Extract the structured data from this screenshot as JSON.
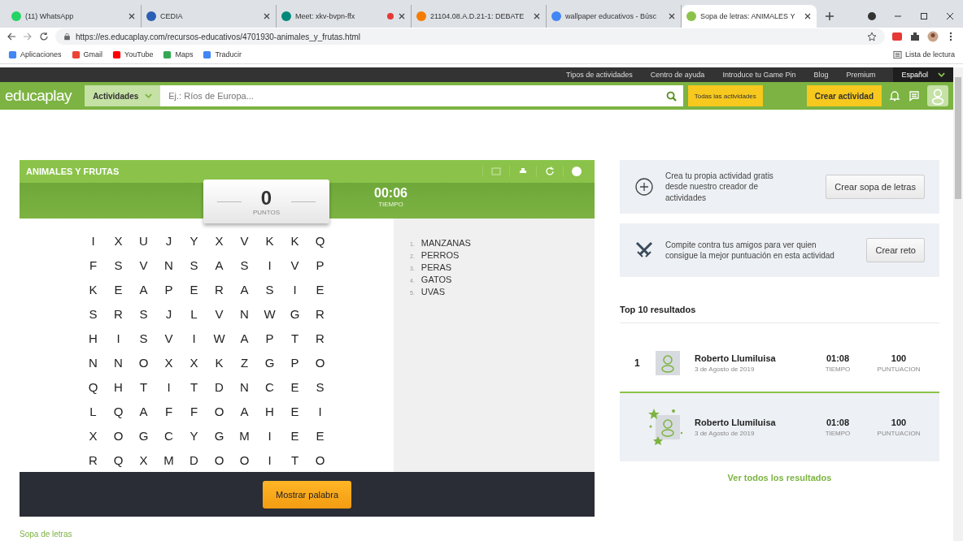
{
  "browser": {
    "tabs": [
      {
        "title": "(11) WhatsApp",
        "selected": false,
        "recording": false,
        "color": "#25d366"
      },
      {
        "title": "CEDIA",
        "selected": false,
        "recording": false,
        "color": "#2b5fb4"
      },
      {
        "title": "Meet: xkv-bvpn-ffx",
        "selected": false,
        "recording": true,
        "color": "#00897b"
      },
      {
        "title": "21104.08.A.D.21-1: DEBATE",
        "selected": false,
        "recording": false,
        "color": "#f57c00"
      },
      {
        "title": "wallpaper educativos - Búsc",
        "selected": false,
        "recording": false,
        "color": "#4285f4"
      },
      {
        "title": "Sopa de letras: ANIMALES Y",
        "selected": true,
        "recording": false,
        "color": "#8bc34a"
      }
    ],
    "url": "https://es.educaplay.com/recursos-educativos/4701930-animales_y_frutas.html",
    "bookmarks": [
      "Aplicaciones",
      "Gmail",
      "YouTube",
      "Maps",
      "Traducir"
    ],
    "reading_list": "Lista de lectura"
  },
  "topbar": {
    "links": [
      "Tipos de actividades",
      "Centro de ayuda",
      "Introduce tu Game Pin",
      "Blog",
      "Premium"
    ],
    "language": "Español"
  },
  "navbar": {
    "logo": "educaplay",
    "activities": "Actividades",
    "search": {
      "placeholder": "Ej.: Ríos de Europa..."
    },
    "all_activities": "Todas las actividades",
    "create": "Crear actividad"
  },
  "game": {
    "title": "ANIMALES Y FRUTAS",
    "score": "0",
    "score_label": "PUNTOS",
    "time": "00:06",
    "time_label": "TIEMPO",
    "grid": [
      [
        "I",
        "X",
        "U",
        "J",
        "Y",
        "X",
        "V",
        "K",
        "K",
        "Q"
      ],
      [
        "F",
        "S",
        "V",
        "N",
        "S",
        "A",
        "S",
        "I",
        "V",
        "P"
      ],
      [
        "K",
        "E",
        "A",
        "P",
        "E",
        "R",
        "A",
        "S",
        "I",
        "E"
      ],
      [
        "S",
        "R",
        "S",
        "J",
        "L",
        "V",
        "N",
        "W",
        "G",
        "R"
      ],
      [
        "H",
        "I",
        "S",
        "V",
        "I",
        "W",
        "A",
        "P",
        "T",
        "R"
      ],
      [
        "N",
        "N",
        "O",
        "X",
        "X",
        "K",
        "Z",
        "G",
        "P",
        "O"
      ],
      [
        "Q",
        "H",
        "T",
        "I",
        "T",
        "D",
        "N",
        "C",
        "E",
        "S"
      ],
      [
        "L",
        "Q",
        "A",
        "F",
        "F",
        "O",
        "A",
        "H",
        "E",
        "I"
      ],
      [
        "X",
        "O",
        "G",
        "C",
        "Y",
        "G",
        "M",
        "I",
        "E",
        "E"
      ],
      [
        "R",
        "Q",
        "X",
        "M",
        "D",
        "O",
        "O",
        "I",
        "T",
        "O"
      ]
    ],
    "words": [
      {
        "number": "1.",
        "word": "MANZANAS"
      },
      {
        "number": "2.",
        "word": "PERROS"
      },
      {
        "number": "3.",
        "word": "PERAS"
      },
      {
        "number": "4.",
        "word": "GATOS"
      },
      {
        "number": "5.",
        "word": "UVAS"
      }
    ],
    "show_word": "Mostrar palabra"
  },
  "cards": [
    {
      "kind": "create",
      "text": "Crea tu propia actividad gratis desde nuestro creador de actividades",
      "button": "Crear sopa de letras"
    },
    {
      "kind": "challenge",
      "text": "Compite contra tus amigos para ver quien consigue la mejor puntuación en esta actividad",
      "button": "Crear reto"
    }
  ],
  "results": {
    "title": "Top 10 resultados",
    "rows": [
      {
        "rank": "1",
        "name": "Roberto Llumiluisa",
        "date": "3 de Agosto de 2019",
        "time": "01:08",
        "time_label": "TIEMPO",
        "score": "100",
        "score_label": "PUNTUACION",
        "highlighted": false
      },
      {
        "name": "Roberto Llumiluisa",
        "date": "3 de Agosto de 2019",
        "time": "01:08",
        "time_label": "TIEMPO",
        "score": "100",
        "score_label": "PUNTUACION",
        "highlighted": true
      }
    ],
    "see_all": "Ver todos los resultados"
  },
  "footer": {
    "heading": "Sopa de letras"
  }
}
